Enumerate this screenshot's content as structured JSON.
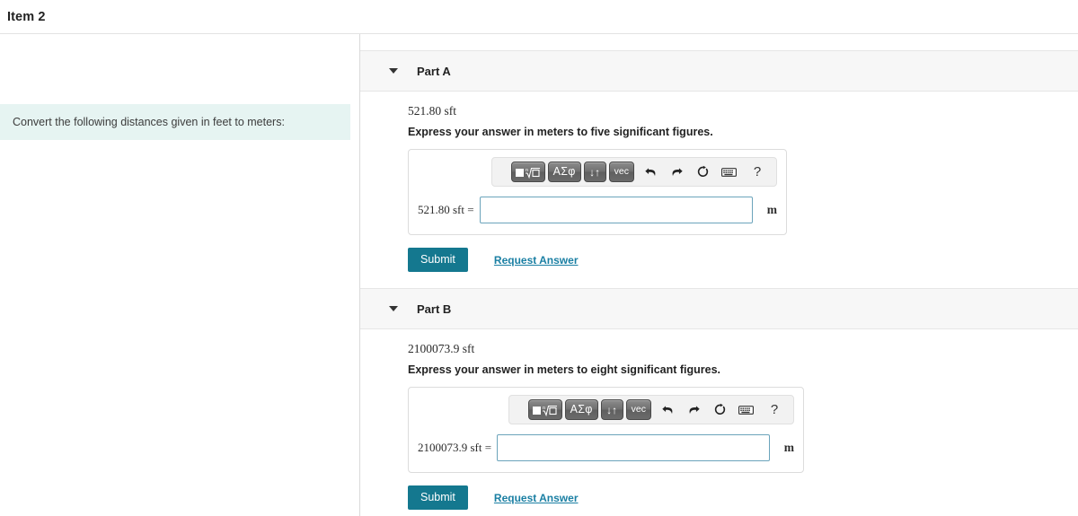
{
  "header": {
    "item_title": "Item 2"
  },
  "left_pane": {
    "problem_statement": "Convert the following distances given in feet to meters:",
    "highlight_color": "#e6f4f2"
  },
  "toolbar": {
    "template_label": "▣√▫",
    "greek_label": "ΑΣφ",
    "arrows_label": "↓↑",
    "vec_label": "vec",
    "undo_label": "↰",
    "redo_label": "↱",
    "reset_label": "↻",
    "keyboard_label": "⌨",
    "help_label": "?"
  },
  "colors": {
    "accent_teal": "#14788f",
    "link_blue": "#1a7fa3",
    "input_border": "#6ba4bb",
    "part_header_bg": "#f7f7f7"
  },
  "parts": [
    {
      "label": "Part A",
      "given": "521.80 sft",
      "instruction": "Express your answer in meters to five significant figures.",
      "answer_prefix": "521.80 sft =",
      "answer_value": "",
      "answer_placeholder": "",
      "unit": "m",
      "submit_label": "Submit",
      "request_label": "Request Answer"
    },
    {
      "label": "Part B",
      "given": "2100073.9 sft",
      "instruction": "Express your answer in meters to eight significant figures.",
      "answer_prefix": "2100073.9 sft =",
      "answer_value": "",
      "answer_placeholder": "",
      "unit": "m",
      "submit_label": "Submit",
      "request_label": "Request Answer"
    }
  ]
}
